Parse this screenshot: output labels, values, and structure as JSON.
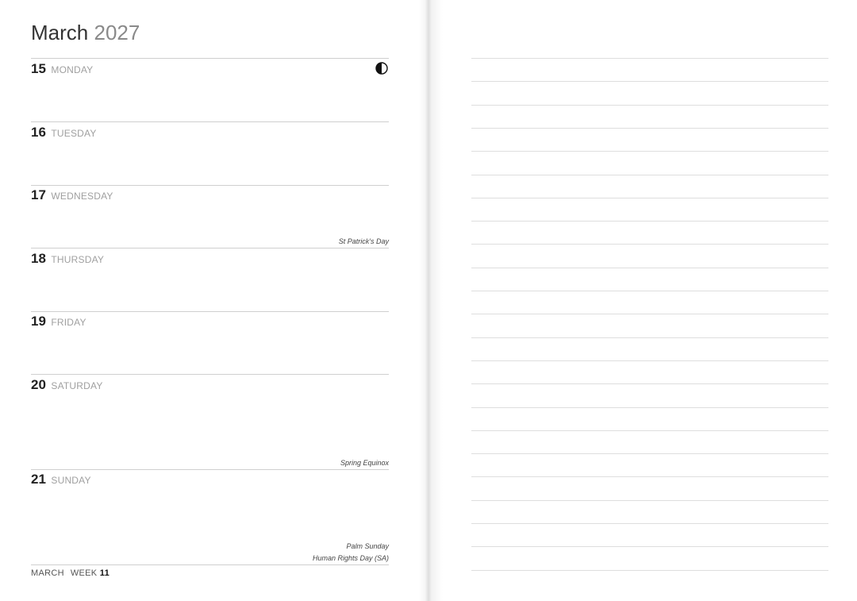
{
  "title": {
    "month": "March",
    "year": "2027"
  },
  "days": [
    {
      "num": "15",
      "name": "MONDAY",
      "events": []
    },
    {
      "num": "16",
      "name": "TUESDAY",
      "events": []
    },
    {
      "num": "17",
      "name": "WEDNESDAY",
      "events": [
        "St Patrick's Day"
      ]
    },
    {
      "num": "18",
      "name": "THURSDAY",
      "events": []
    },
    {
      "num": "19",
      "name": "FRIDAY",
      "events": []
    },
    {
      "num": "20",
      "name": "SATURDAY",
      "events": [
        "Spring Equinox"
      ]
    },
    {
      "num": "21",
      "name": "SUNDAY",
      "events": [
        "Palm Sunday",
        "Human Rights Day (SA)"
      ]
    }
  ],
  "moon_phase_icon": "half-moon-icon",
  "footer": {
    "month": "MARCH",
    "week_label": "WEEK",
    "week_num": "11"
  }
}
